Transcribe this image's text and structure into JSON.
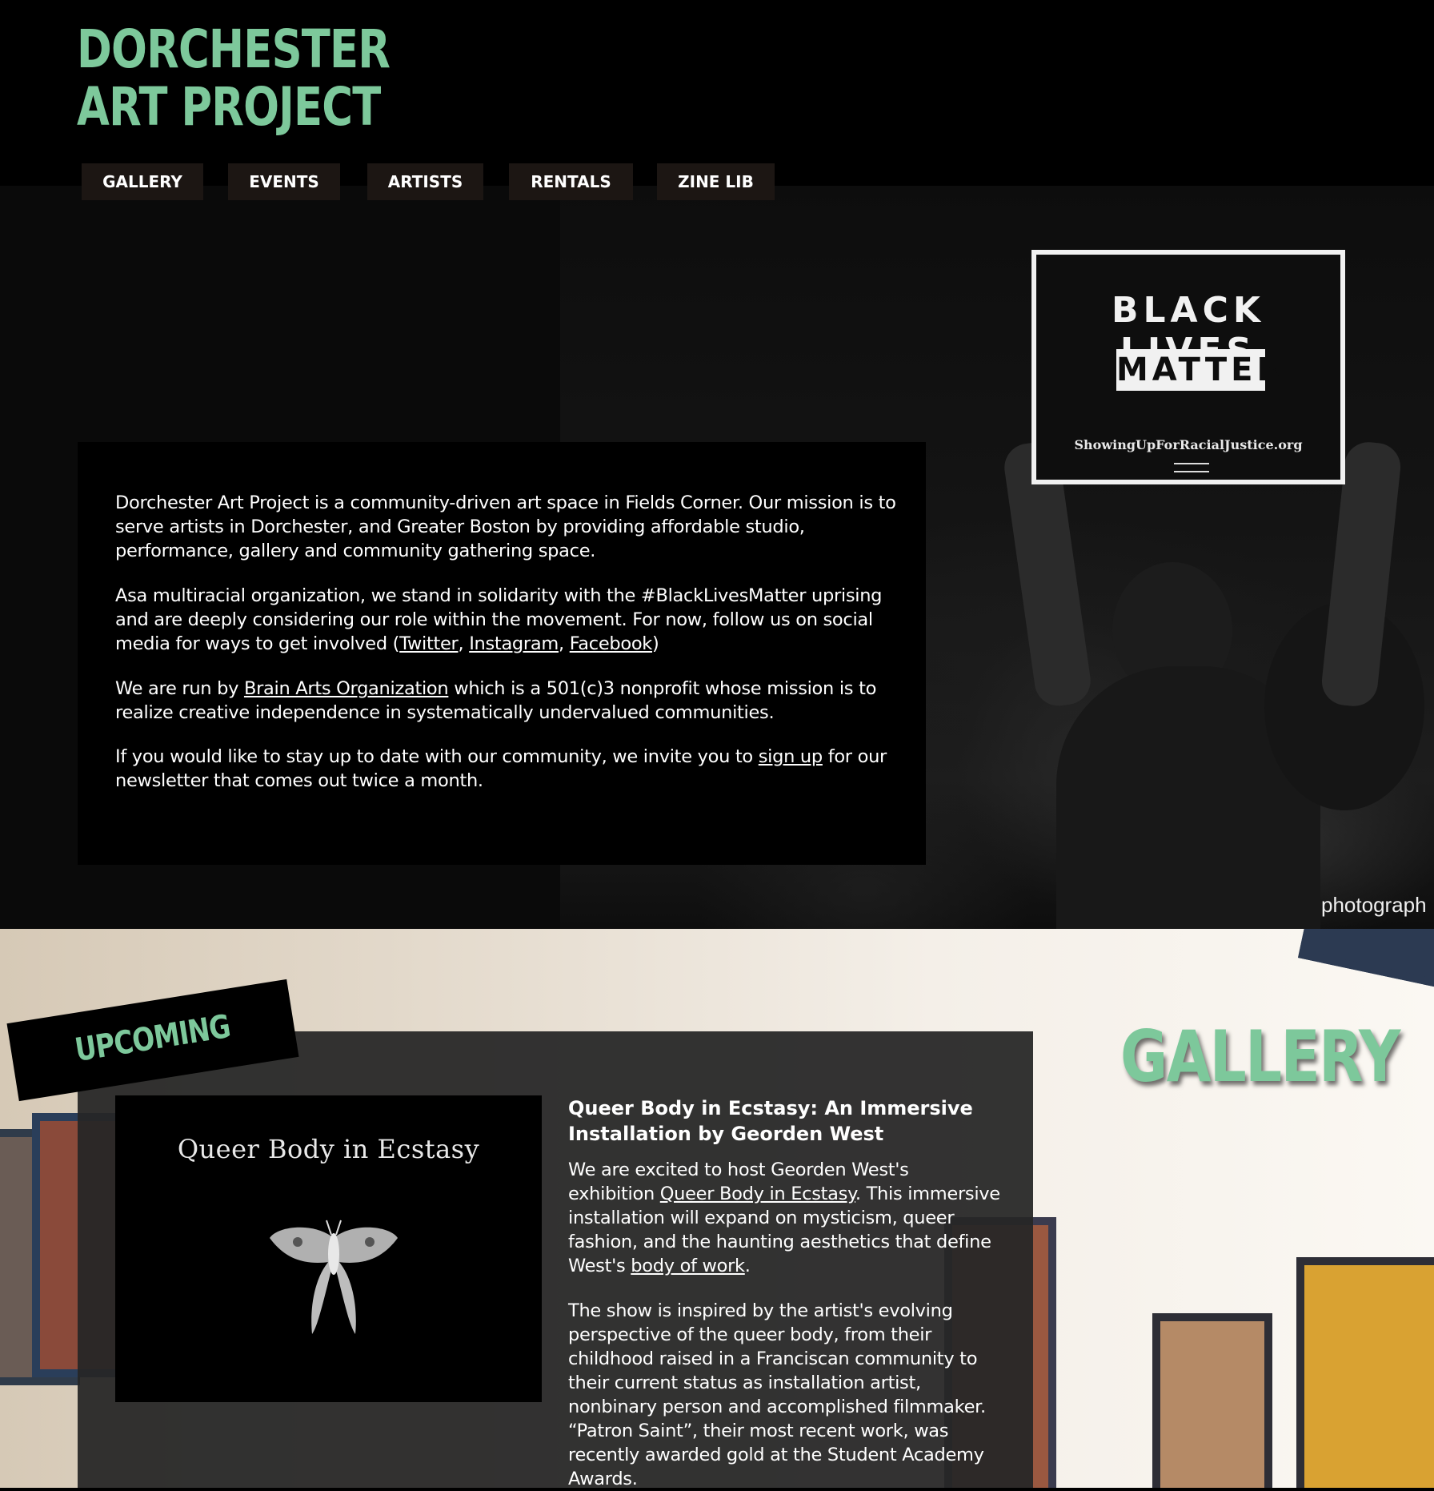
{
  "logo": {
    "line1": "DORCHESTER",
    "line2": "ART PROJECT"
  },
  "nav": [
    {
      "label": "GALLERY"
    },
    {
      "label": "EVENTS"
    },
    {
      "label": "ARTISTS"
    },
    {
      "label": "RENTALS"
    },
    {
      "label": "ZINE LIB"
    }
  ],
  "hero": {
    "sign_line1": "BLACK  LIVES",
    "sign_line2": "MATTER",
    "sign_url": "ShowingUpForRacialJustice.org",
    "photo_credit": "photograph"
  },
  "intro": {
    "p1": "Dorchester Art Project is a community-driven art space in Fields Corner. Our mission is to serve artists in Dorchester, and Greater Boston by providing affordable studio, performance, gallery and community gathering space.",
    "p2_before": "Asa multiracial organization, we stand in solidarity with the #BlackLivesMatter uprising and are deeply considering our role within the movement. For now, follow us on social media for ways to get involved (",
    "p2_link_twitter": "Twitter",
    "p2_sep1": ", ",
    "p2_link_instagram": "Instagram",
    "p2_sep2": ",  ",
    "p2_link_facebook": "Facebook",
    "p2_after": ")",
    "p3_before": "We are run by ",
    "p3_link": "Brain Arts Organization",
    "p3_after": " which is a 501(c)3 nonprofit whose mission is to realize creative independence in systematically undervalued communities.",
    "p4_before": "If you would like to stay up to date with our community, we invite you to ",
    "p4_link": "sign up",
    "p4_after": " for our newsletter that comes out twice a month."
  },
  "gallery": {
    "heading": "GALLERY",
    "upcoming_label": "UPCOMING",
    "event": {
      "image_title": "Queer Body in Ecstasy",
      "title": "Queer Body in Ecstasy: An Immersive Installation by Georden West",
      "p1_before": "We are excited to host Georden West's exhibition ",
      "p1_link": "Queer Body in Ecstasy",
      "p1_mid": ". This immersive installation will expand on mysticism, queer fashion, and the haunting aesthetics that define West's ",
      "p1_link2": "body of work",
      "p1_after": ".",
      "p2": "The show is inspired by the artist's evolving perspective of the queer body, from their childhood raised in a Franciscan community to their current status as installation artist, nonbinary person and accomplished filmmaker. “Patron Saint”, their most recent work, was recently awarded gold at the Student Academy Awards."
    }
  },
  "colors": {
    "accent": "#7dc89b",
    "nav_bg": "#1c1613",
    "panel_bg": "#262626"
  }
}
